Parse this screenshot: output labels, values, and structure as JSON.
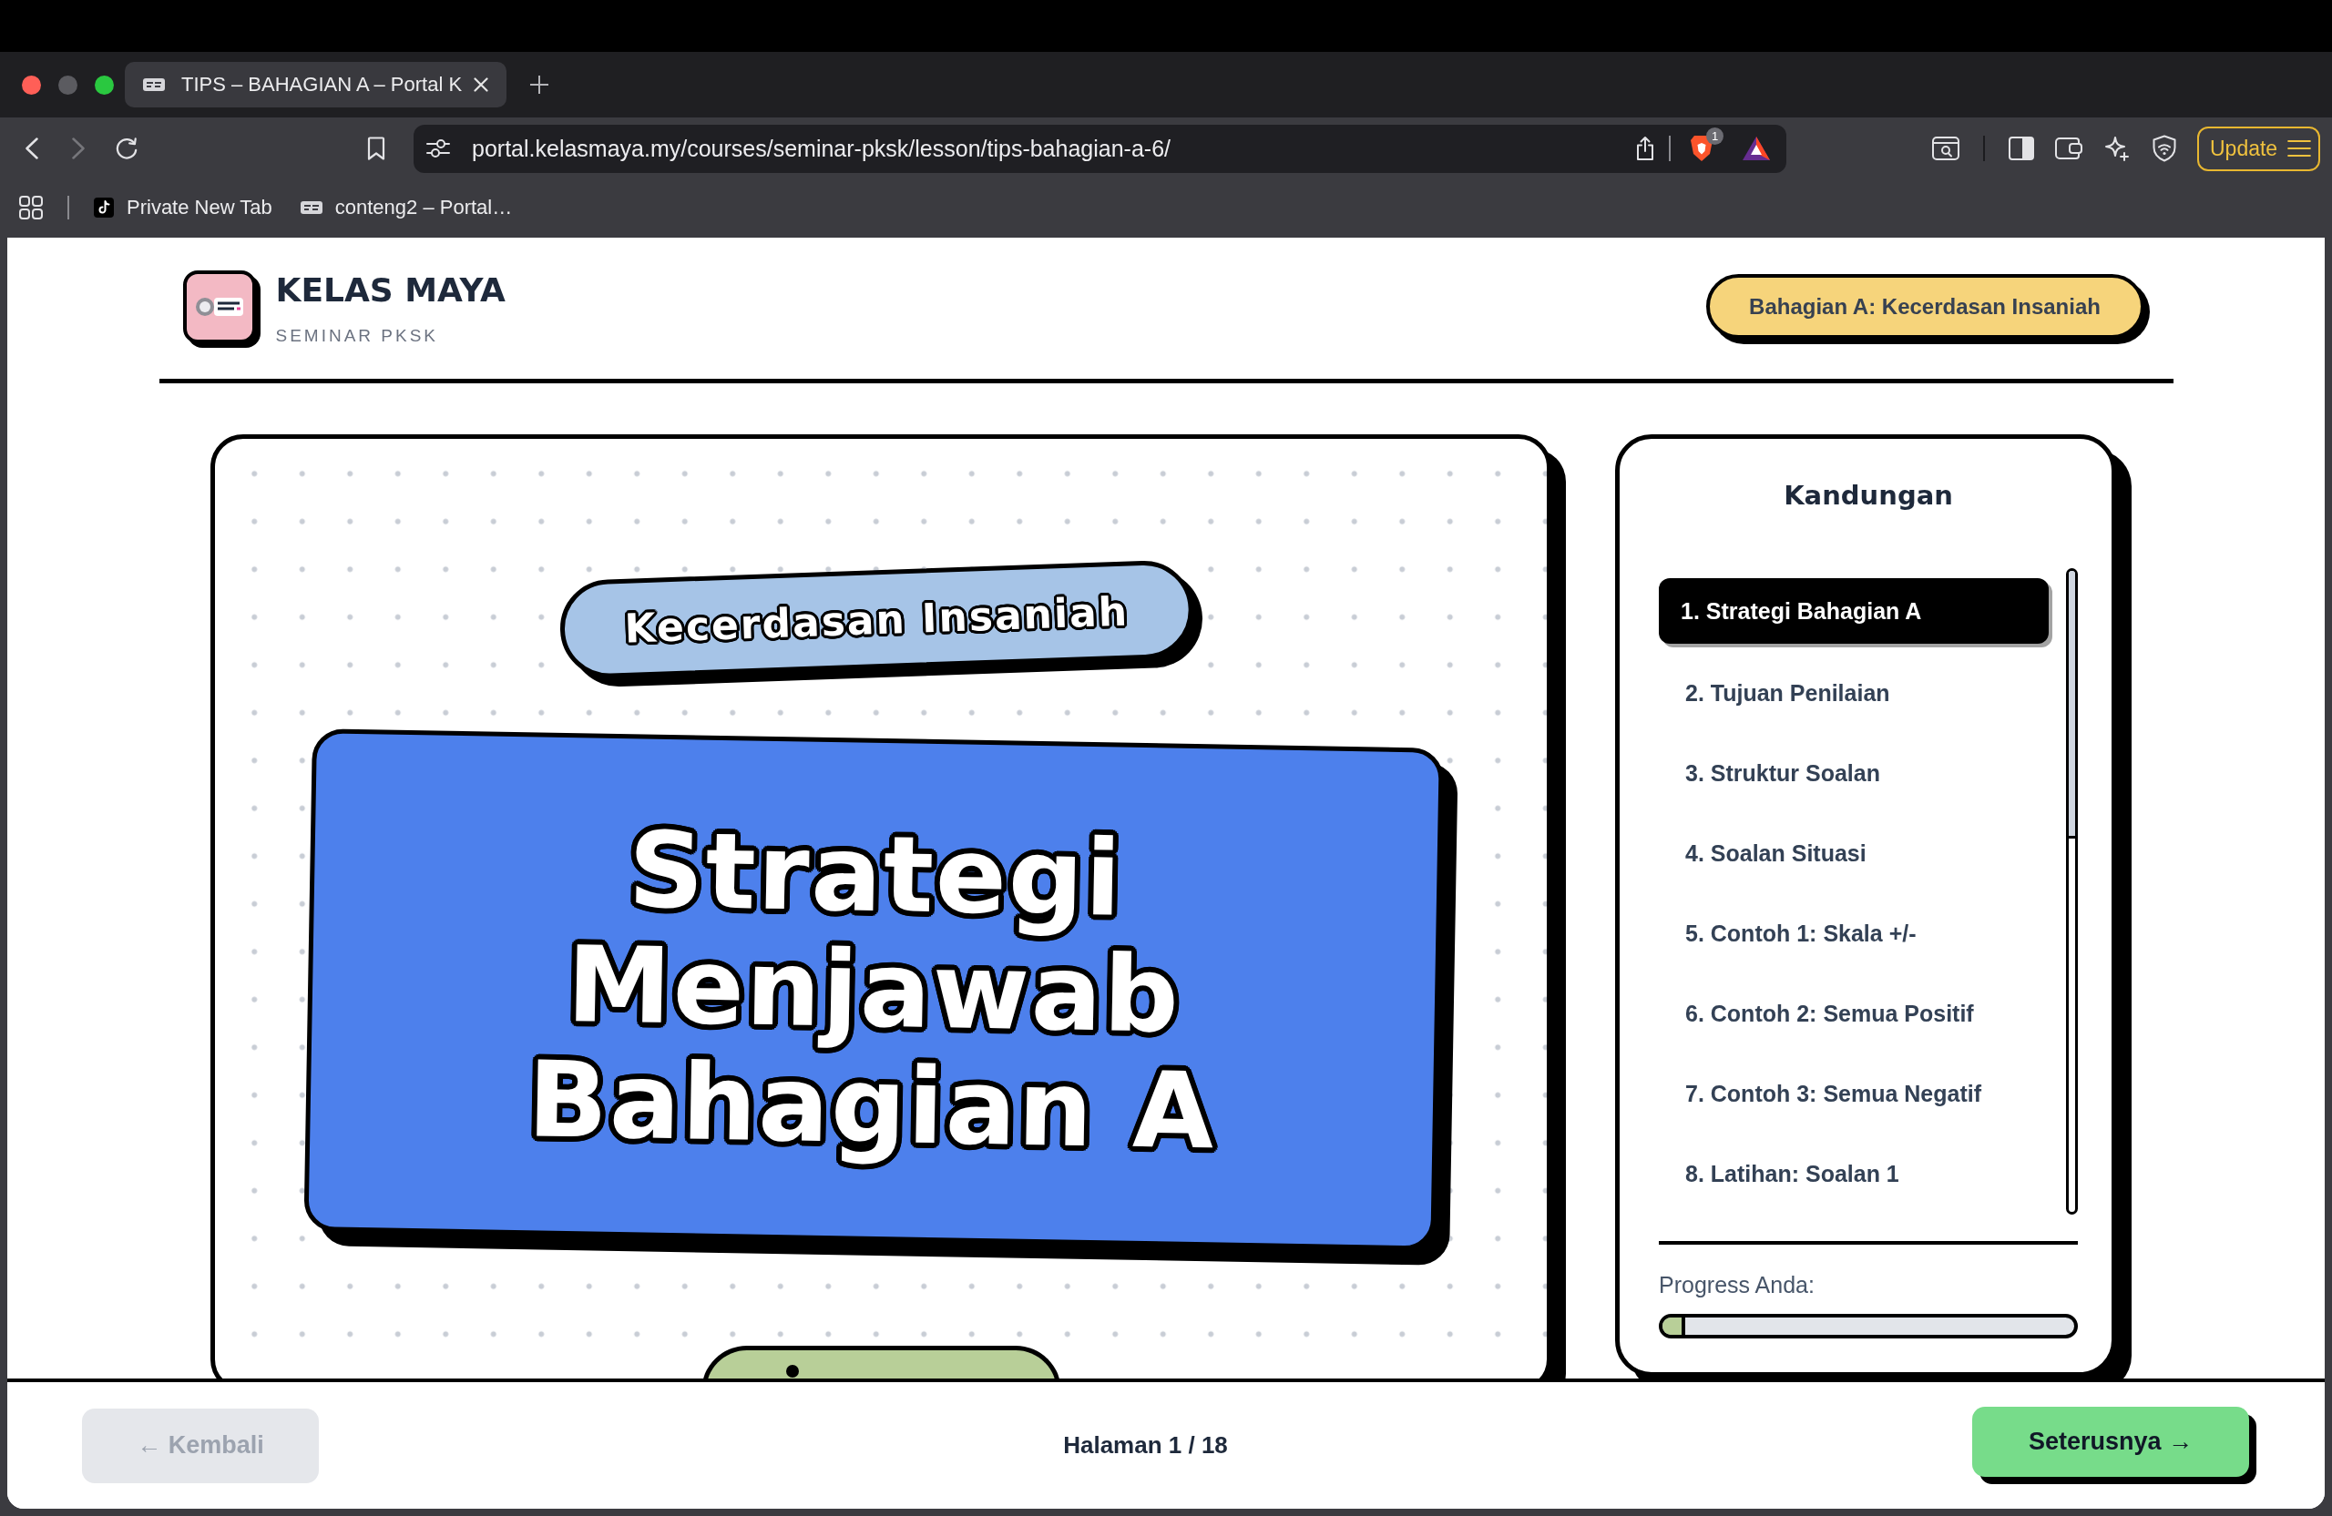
{
  "browser": {
    "tabs": [
      {
        "title": "TIPS – BAHAGIAN A – Portal K",
        "selected": true
      }
    ],
    "navigation": {
      "back_disabled": false,
      "forward_disabled": true
    },
    "address_bar": {
      "url": "portal.kelasmaya.my/courses/seminar-pksk/lesson/tips-bahagian-a-6/",
      "shields_badge": "1"
    },
    "update_button": "Update",
    "bookmarks": [
      {
        "kind": "tiktok",
        "label": "Private New Tab"
      },
      {
        "kind": "site",
        "label": "conteng2 – Portal…"
      }
    ]
  },
  "header": {
    "brand": "KELAS MAYA",
    "subtitle": "SEMINAR PKSK",
    "section_badge": "Bahagian A: Kecerdasan Insaniah"
  },
  "slide": {
    "tag": "Kecerdasan Insaniah",
    "title": "Strategi Menjawab Bahagian A"
  },
  "contents": {
    "title": "Kandungan",
    "items": [
      {
        "label": "1. Strategi Bahagian A",
        "selected": true
      },
      {
        "label": "2. Tujuan Penilaian",
        "selected": false
      },
      {
        "label": "3. Struktur Soalan",
        "selected": false
      },
      {
        "label": "4. Soalan Situasi",
        "selected": false
      },
      {
        "label": "5. Contoh 1: Skala +/-",
        "selected": false
      },
      {
        "label": "6. Contoh 2: Semua Positif",
        "selected": false
      },
      {
        "label": "7. Contoh 3: Semua Negatif",
        "selected": false
      },
      {
        "label": "8. Latihan: Soalan 1",
        "selected": false
      }
    ],
    "progress_label": "Progress Anda:",
    "progress": {
      "level": 0.056
    }
  },
  "footer": {
    "back_button": {
      "label": "← Kembali",
      "disabled": true
    },
    "page_indicator": "Halaman 1 / 18",
    "next_button": {
      "label": "Seterusnya →",
      "disabled": false
    }
  }
}
